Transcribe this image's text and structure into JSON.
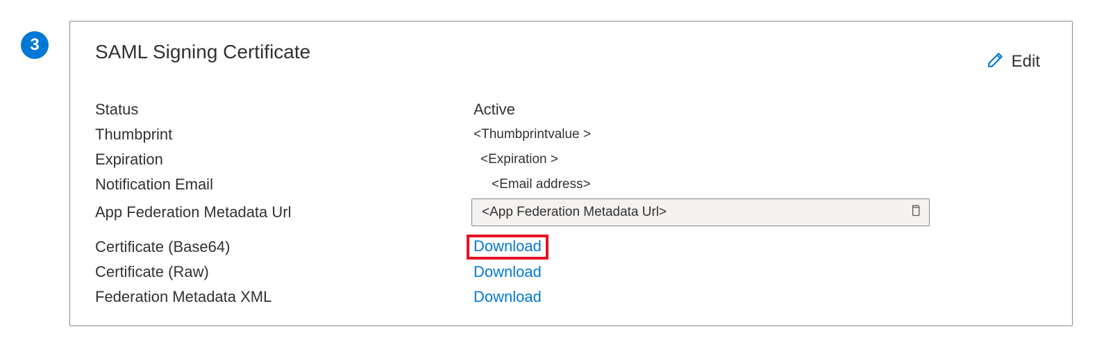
{
  "step": {
    "number": "3"
  },
  "card": {
    "title": "SAML Signing Certificate",
    "edit_label": "Edit",
    "rows": {
      "status": {
        "label": "Status",
        "value": "Active"
      },
      "thumbprint": {
        "label": "Thumbprint",
        "value": "<Thumbprintvalue >"
      },
      "expiration": {
        "label": "Expiration",
        "value": "<Expiration >"
      },
      "notification_email": {
        "label": "Notification Email",
        "value": "<Email address>"
      },
      "metadata_url": {
        "label": "App Federation Metadata Url",
        "value": "<App Federation Metadata Url>"
      },
      "cert_base64": {
        "label": "Certificate (Base64)",
        "action": "Download"
      },
      "cert_raw": {
        "label": "Certificate (Raw)",
        "action": "Download"
      },
      "fed_xml": {
        "label": "Federation Metadata XML",
        "action": "Download"
      }
    }
  }
}
